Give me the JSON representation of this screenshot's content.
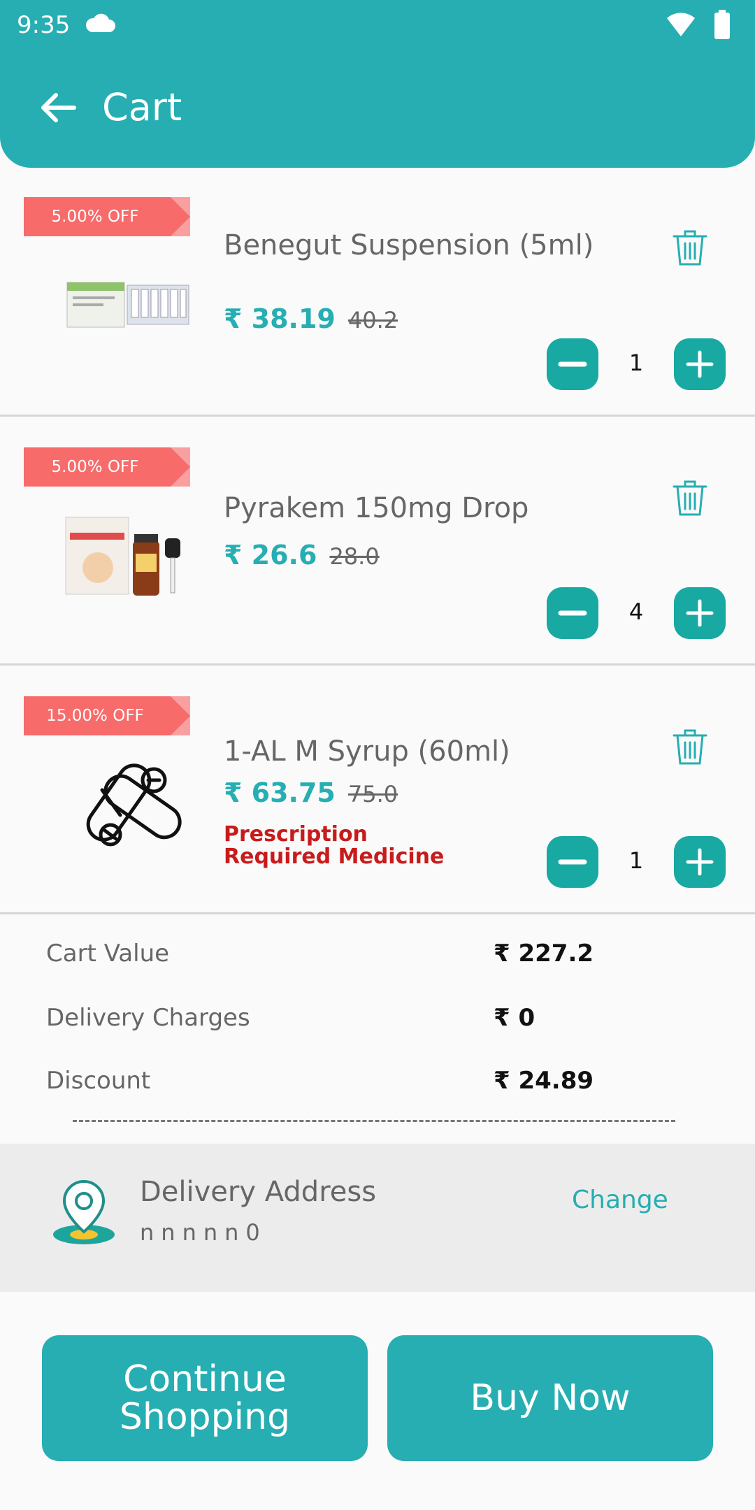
{
  "status_bar": {
    "time": "9:35",
    "icons": [
      "cloud-icon",
      "wifi-icon",
      "battery-icon"
    ]
  },
  "header": {
    "title": "Cart",
    "back_icon": "arrow-left-icon"
  },
  "items": [
    {
      "discount": "5.00% OFF",
      "name": "Benegut Suspension (5ml)",
      "price": "₹ 38.19",
      "old_price": "40.2",
      "qty": "1",
      "rx": ""
    },
    {
      "discount": "5.00% OFF",
      "name": "Pyrakem 150mg Drop",
      "price": "₹ 26.6",
      "old_price": "28.0",
      "qty": "4",
      "rx": ""
    },
    {
      "discount": "15.00% OFF",
      "name": "1-AL M Syrup (60ml)",
      "price": "₹ 63.75",
      "old_price": "75.0",
      "qty": "1",
      "rx": "Prescription Required Medicine"
    }
  ],
  "summary": {
    "cart_value_label": "Cart Value",
    "cart_value": "₹ 227.2",
    "delivery_label": "Delivery Charges",
    "delivery_value": "₹ 0",
    "discount_label": "Discount",
    "discount_value": "₹ 24.89"
  },
  "address": {
    "title": "Delivery Address",
    "line": "nnnnn0",
    "change_label": "Change"
  },
  "actions": {
    "continue_label": "Continue Shopping",
    "buy_label": "Buy Now"
  },
  "colors": {
    "primary": "#26aeb2",
    "discount": "#f76b6b",
    "rx": "#c81b1b"
  }
}
